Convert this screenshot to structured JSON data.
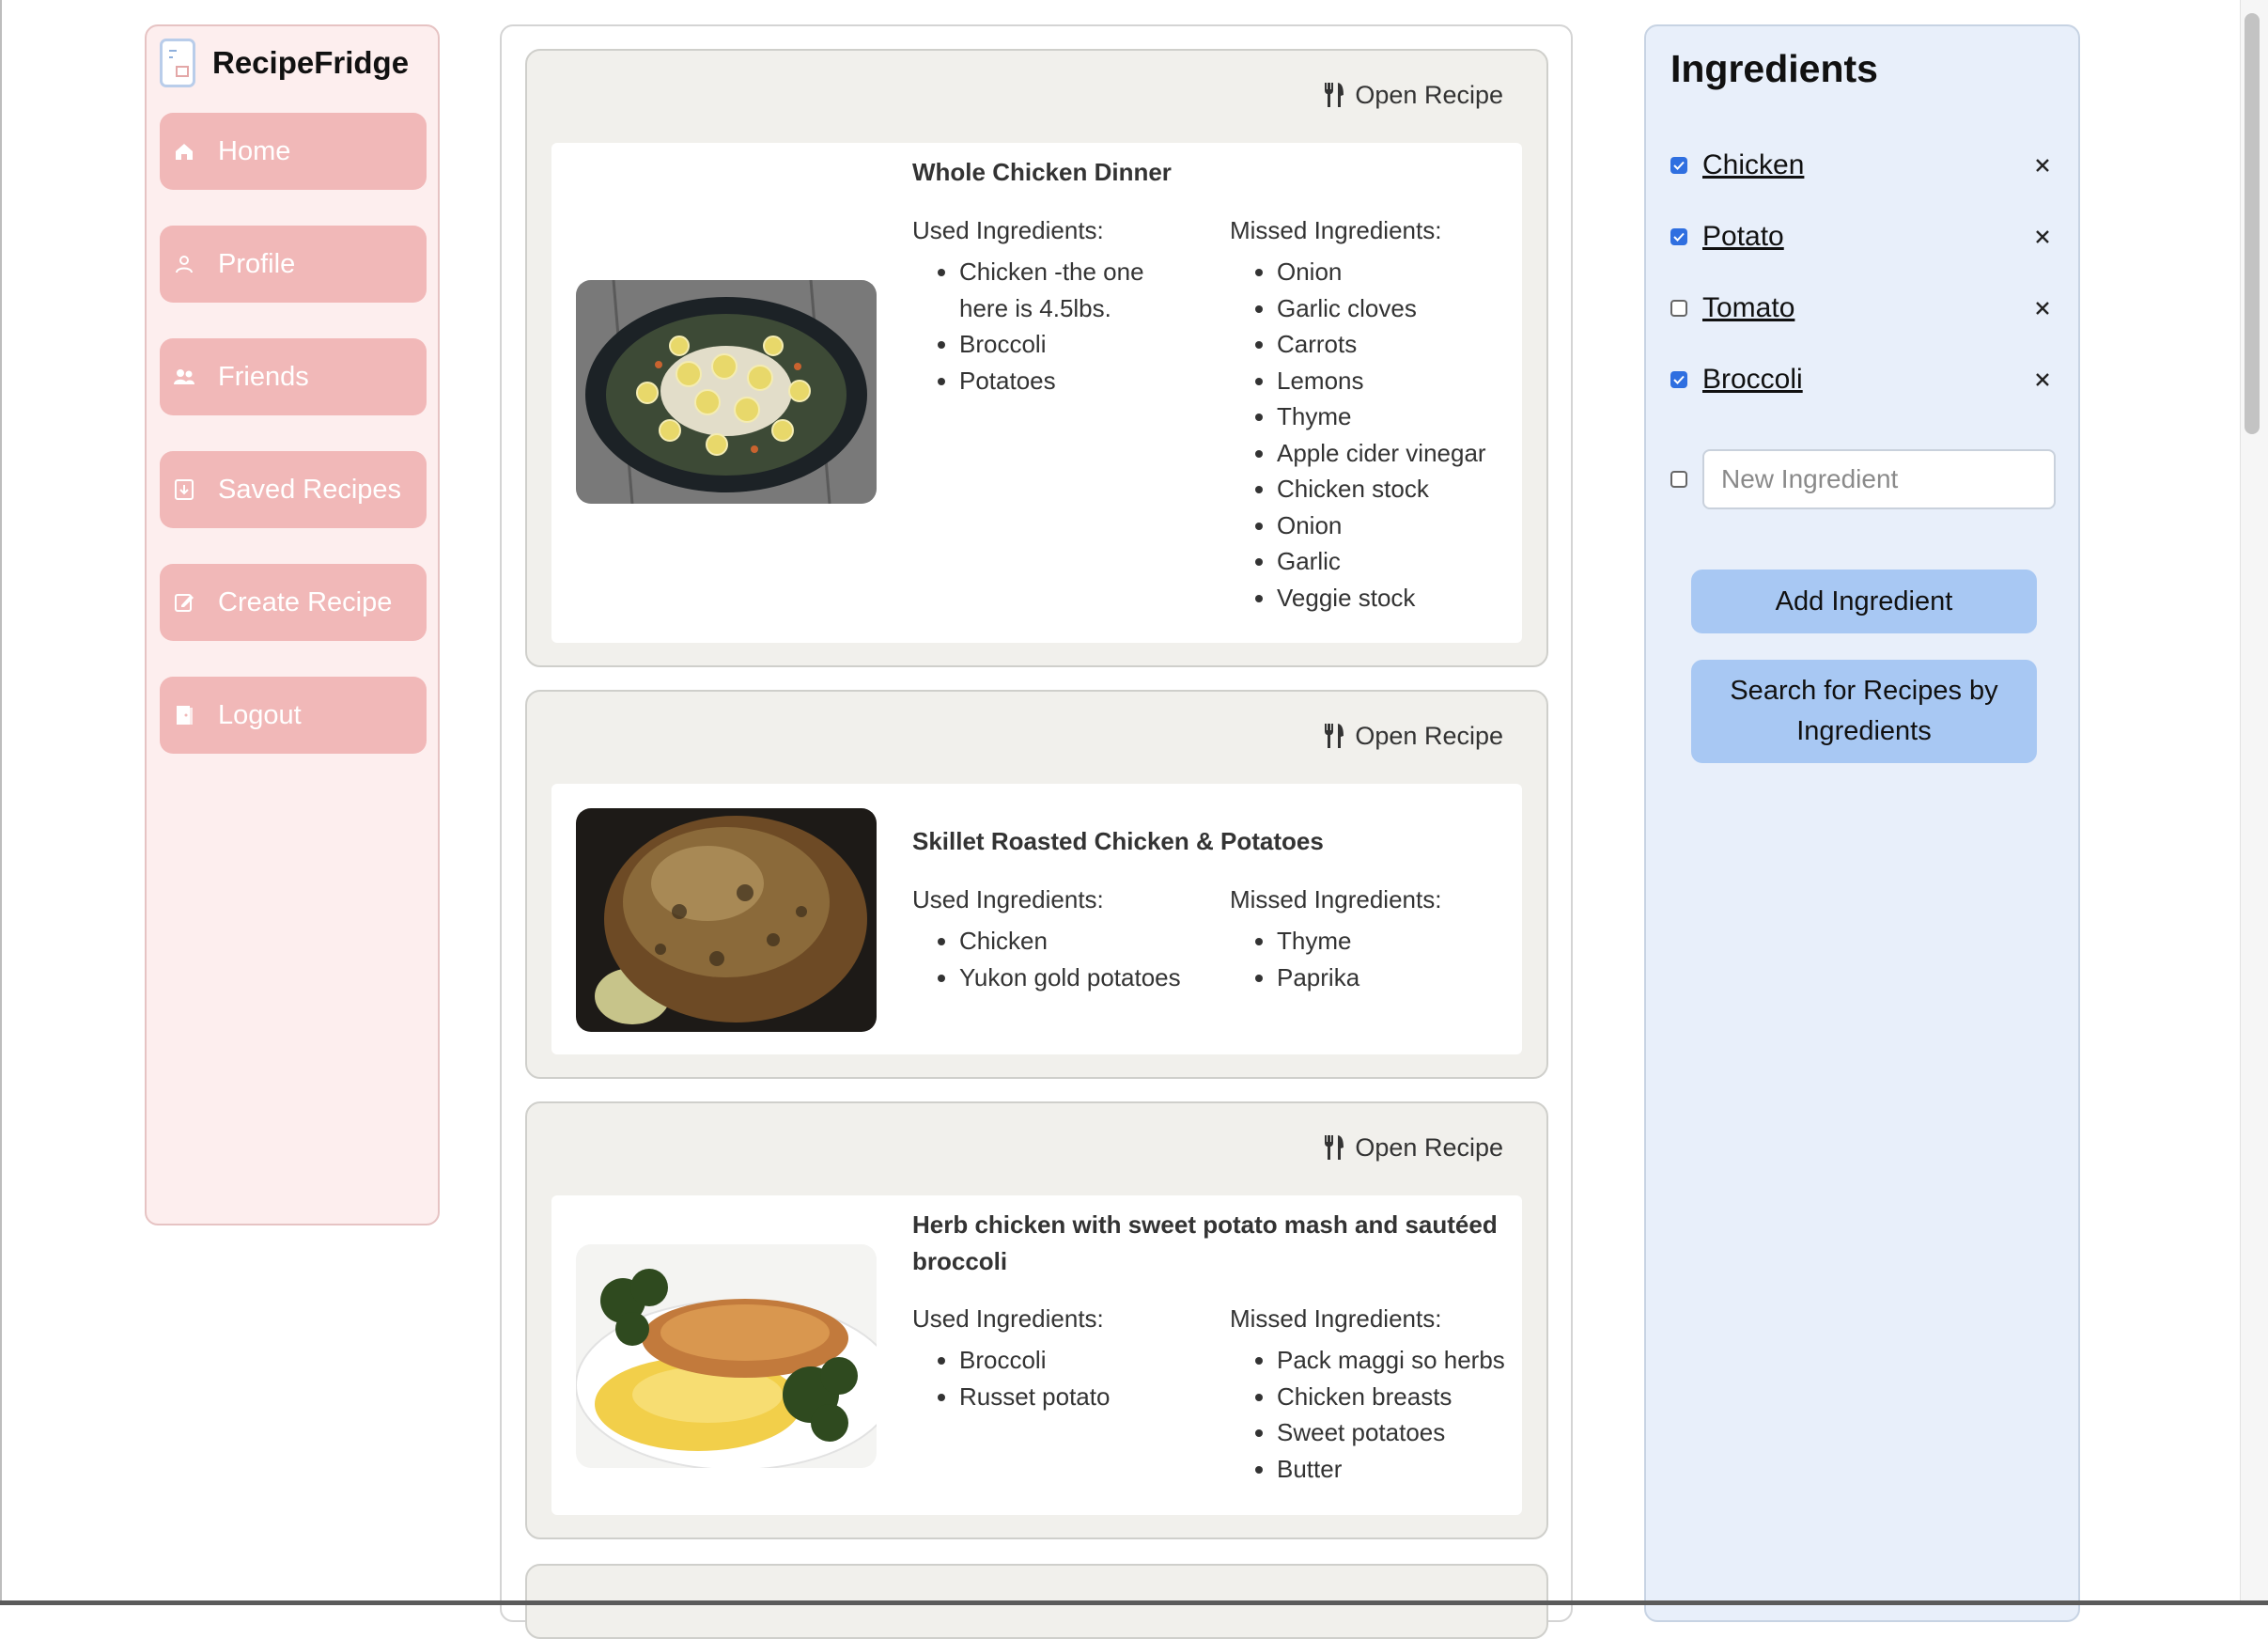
{
  "brand": {
    "name": "RecipeFridge",
    "logo_icon": "fridge-logo-icon"
  },
  "nav": [
    {
      "label": "Home",
      "icon": "home-icon"
    },
    {
      "label": "Profile",
      "icon": "profile-icon"
    },
    {
      "label": "Friends",
      "icon": "friends-icon"
    },
    {
      "label": "Saved Recipes",
      "icon": "saved-recipes-icon"
    },
    {
      "label": "Create Recipe",
      "icon": "create-recipe-icon"
    },
    {
      "label": "Logout",
      "icon": "logout-icon"
    }
  ],
  "recipes": [
    {
      "open_label": "Open Recipe",
      "title": "Whole Chicken Dinner",
      "used_heading": "Used Ingredients:",
      "missed_heading": "Missed Ingredients:",
      "used": [
        "Chicken -the one here is 4.5lbs.",
        "Broccoli",
        "Potatoes"
      ],
      "missed": [
        "Onion",
        "Garlic cloves",
        "Carrots",
        "Lemons",
        "Thyme",
        "Apple cider vinegar",
        "Chicken stock",
        "Onion",
        "Garlic",
        "Veggie stock"
      ]
    },
    {
      "open_label": "Open Recipe",
      "title": "Skillet Roasted Chicken & Potatoes",
      "used_heading": "Used Ingredients:",
      "missed_heading": "Missed Ingredients:",
      "used": [
        "Chicken",
        "Yukon gold potatoes"
      ],
      "missed": [
        "Thyme",
        "Paprika"
      ]
    },
    {
      "open_label": "Open Recipe",
      "title": "Herb chicken with sweet potato mash and sautéed broccoli",
      "used_heading": "Used Ingredients:",
      "missed_heading": "Missed Ingredients:",
      "used": [
        "Broccoli",
        "Russet potato"
      ],
      "missed": [
        "Pack maggi so herbs",
        "Chicken breasts",
        "Sweet potatoes",
        "Butter"
      ]
    }
  ],
  "ingredients_panel": {
    "heading": "Ingredients",
    "items": [
      {
        "name": "Chicken",
        "checked": true
      },
      {
        "name": "Potato",
        "checked": true
      },
      {
        "name": "Tomato",
        "checked": false
      },
      {
        "name": "Broccoli",
        "checked": true
      }
    ],
    "new_ingredient_placeholder": "New Ingredient",
    "add_button": "Add Ingredient",
    "search_button": "Search for Recipes by Ingredients"
  },
  "colors": {
    "sidebar_bg": "#fdeeee",
    "nav_button": "#f1b8b8",
    "card_bg": "#f1f0ec",
    "ingredients_bg": "#e8effa",
    "primary_button": "#a8c8f3",
    "checkbox_checked": "#2f6fe0"
  }
}
